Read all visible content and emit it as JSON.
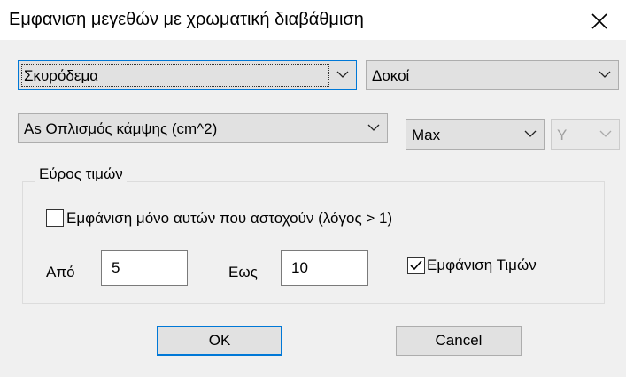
{
  "window": {
    "title": "Εμφανιση μεγεθών με χρωματική διαβάθμιση"
  },
  "selectors": {
    "material": "Σκυρόδεμα",
    "element_type": "Δοκοί",
    "quantity": "As Οπλισμός κάμψης (cm^2)",
    "aggregate": "Max",
    "axis": "Y"
  },
  "range": {
    "group_label": "Εύρος τιμών",
    "only_failing_label": "Εμφάνιση μόνο αυτών που αστοχούν (λόγος > 1)",
    "only_failing_checked": false,
    "from_label": "Από",
    "from_value": "5",
    "to_label": "Εως",
    "to_value": "10",
    "show_values_label": "Εμφάνιση Τιμών",
    "show_values_checked": true
  },
  "buttons": {
    "ok": "OK",
    "cancel": "Cancel"
  },
  "colors": {
    "focus_accent": "#0078d7",
    "dialog_bg": "#f0f0f0",
    "title_bg": "#ffffff"
  }
}
